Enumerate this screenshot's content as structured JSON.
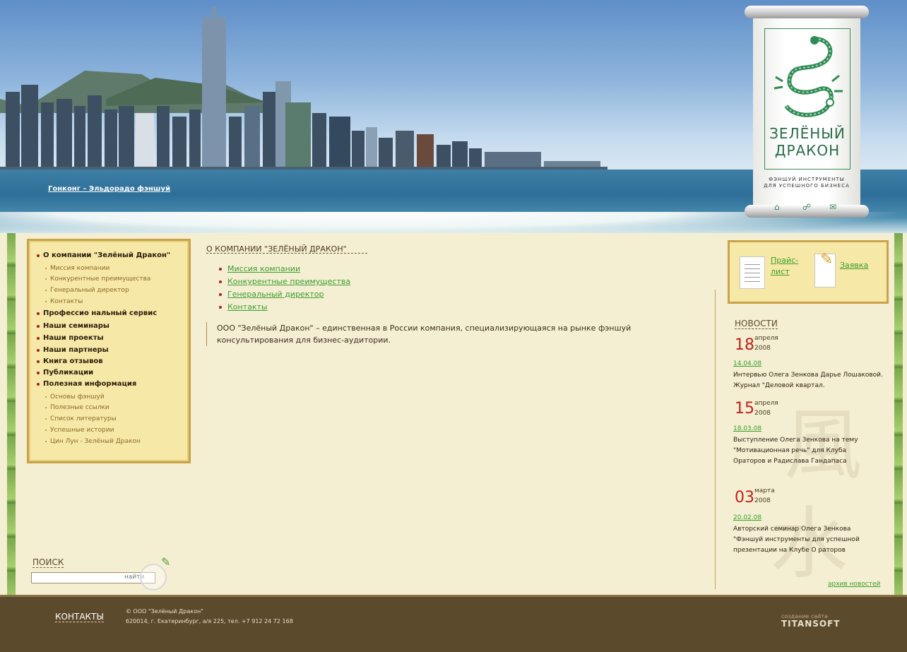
{
  "header": {
    "caption_link": "Гонконг – Эльдорадо фэншуй"
  },
  "logo": {
    "title_line1": "ЗЕЛЁНЫЙ",
    "title_line2": "ДРАКОН",
    "subtitle_line1": "ФЭНШУЙ ИНСТРУМЕНТЫ",
    "subtitle_line2": "ДЛЯ УСПЕШНОГО БИЗНЕСА",
    "icons": [
      "home-icon",
      "sitemap-icon",
      "mail-icon"
    ]
  },
  "sidebar": {
    "items": [
      {
        "label": "О компании \"Зелёный Дракон\"",
        "level": 1
      },
      {
        "label": "Миссия компании",
        "level": 2
      },
      {
        "label": "Конкурентные преимущества",
        "level": 2
      },
      {
        "label": "Генеральный директор",
        "level": 2
      },
      {
        "label": "Контакты",
        "level": 2
      },
      {
        "label": "Профессио нальный сервис",
        "level": 1
      },
      {
        "label": "Наши семинары",
        "level": 1
      },
      {
        "label": "Наши проекты",
        "level": 1
      },
      {
        "label": "Наши партнеры",
        "level": 1
      },
      {
        "label": "Книга отзывов",
        "level": 1
      },
      {
        "label": "Публикации",
        "level": 1
      },
      {
        "label": "Полезная информация",
        "level": 1
      },
      {
        "label": "Основы фэншуй",
        "level": 2
      },
      {
        "label": "Полезные ссылки",
        "level": 2
      },
      {
        "label": "Список литературы",
        "level": 2
      },
      {
        "label": "Успешные истории",
        "level": 2
      },
      {
        "label": "Цин Лун - Зелёный Дракон",
        "level": 2
      }
    ]
  },
  "search": {
    "title": "ПОИСК",
    "button_label": "найти",
    "value": ""
  },
  "main": {
    "title": "О КОМПАНИИ \"ЗЕЛЁНЫЙ ДРАКОН\"",
    "links": [
      "Миссия компании",
      "Конкурентные преимущества",
      "Генеральный директор",
      "Контакты"
    ],
    "text": "ООО \"Зелёный Дракон\" – единственная в России компания, специализирующаяся на рынке фэншуй консультирования для бизнес-аудитории."
  },
  "pricebox": {
    "price_label": "Прайс-лист",
    "order_label": "Заявка"
  },
  "news": {
    "title": "НОВОСТИ",
    "items": [
      {
        "day": "18",
        "month": "апреля",
        "year": "2008",
        "date": "14.04.08",
        "text": "Интервью Олега Зенкова Дарье Лошаковой. Журнал \"Деловой квартал."
      },
      {
        "day": "15",
        "month": "апреля",
        "year": "2008",
        "date": "18.03.08",
        "text": "Выступление Олега Зенкова на тему \"Мотивационная речь\" для Клуба Ораторов и Радислава Гандапаса"
      },
      {
        "day": "03",
        "month": "марта",
        "year": "2008",
        "date": "20.02.08",
        "text": "Авторский семинар Олега Зенкова \"Фэншуй инструменты для успешной презентации на Клубе О раторов"
      }
    ],
    "archive_label": "архив новостей"
  },
  "footer": {
    "contacts_label": "КОНТАКТЫ",
    "copyright": "© ООО \"Зелёный Дракон\"",
    "address": "620014, г. Екатеринбург, а/я 225, тел. +7 912 24 72 168",
    "developer_caption": "создание сайта",
    "developer_name": "TITANSOFT"
  }
}
